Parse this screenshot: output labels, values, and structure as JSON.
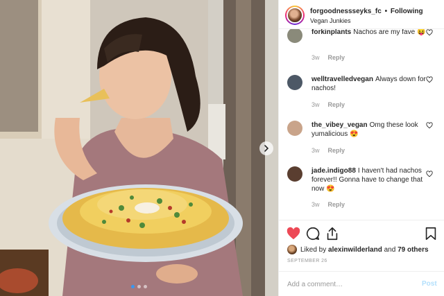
{
  "post": {
    "username": "forgoodnessseyks_fc",
    "follow_separator": "•",
    "follow_status": "Following",
    "location": "Vegan Junkies",
    "date": "SEPTEMBER 26",
    "likes": {
      "prefix": "Liked by",
      "first_user": "alexinwilderland",
      "conjunction": "and",
      "others": "79 others"
    }
  },
  "comments": [
    {
      "user": "forkinplants",
      "text": "Nachos are my fave 😝",
      "age": "3w",
      "reply": "Reply",
      "avatar_color": "#8a8a7a"
    },
    {
      "user": "welltravelledvegan",
      "text": "Always down for nachos!",
      "age": "3w",
      "reply": "Reply",
      "avatar_color": "#4d5866"
    },
    {
      "user": "the_vibey_vegan",
      "text": "Omg these look yumalicious 😍",
      "age": "3w",
      "reply": "Reply",
      "avatar_color": "#c9a48a"
    },
    {
      "user": "jade.indigo88",
      "text": "I haven't had nachos forever!! Gonna have to change that now 😍",
      "age": "3w",
      "reply": "Reply",
      "avatar_color": "#5a3e30"
    }
  ],
  "composer": {
    "placeholder": "Add a comment…",
    "post_label": "Post"
  },
  "colors": {
    "like_red": "#ed4956",
    "link_blue": "#3897f0",
    "post_disabled": "#b2dffc",
    "muted": "#999999"
  },
  "carousel": {
    "slides": 3,
    "active_index": 0
  }
}
